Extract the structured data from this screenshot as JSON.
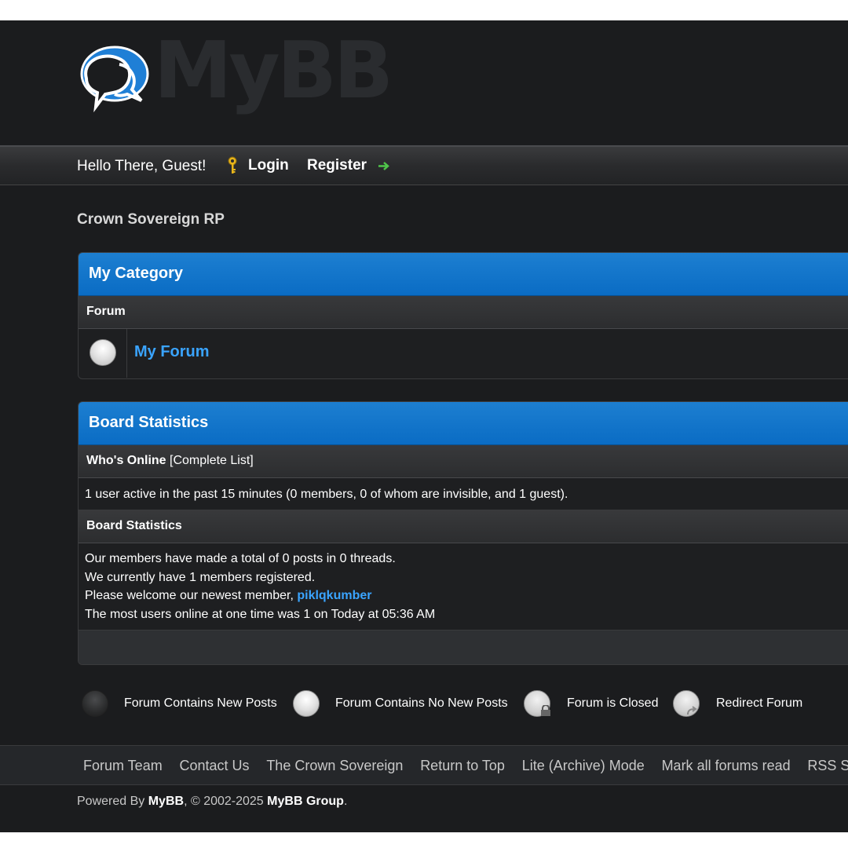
{
  "header": {
    "logo_text": "MyBB"
  },
  "top_bar": {
    "greeting": "Hello There, Guest!",
    "login": "Login",
    "register": "Register"
  },
  "breadcrumb": "Crown Sovereign RP",
  "category": {
    "title": "My Category",
    "column_header": "Forum",
    "forums": [
      {
        "name": "My Forum"
      }
    ]
  },
  "board_statistics": {
    "title": "Board Statistics",
    "whos_online_label": "Who's Online",
    "complete_list": "[Complete List]",
    "online_text": "1 user active in the past 15 minutes (0 members, 0 of whom are invisible, and 1 guest).",
    "stats_header": "Board Statistics",
    "line1": "Our members have made a total of 0 posts in 0 threads.",
    "line2": "We currently have 1 members registered.",
    "line3_prefix": "Please welcome our newest member, ",
    "newest_member": "piklqkumber",
    "line4": "The most users online at one time was 1 on Today at 05:36 AM"
  },
  "legend": {
    "new_posts": "Forum Contains New Posts",
    "no_new_posts": "Forum Contains No New Posts",
    "closed": "Forum is Closed",
    "redirect": "Redirect Forum"
  },
  "footer": {
    "links": [
      "Forum Team",
      "Contact Us",
      "The Crown Sovereign",
      "Return to Top",
      "Lite (Archive) Mode",
      "Mark all forums read",
      "RSS Syndication"
    ],
    "powered_prefix": "Powered By ",
    "powered_name": "MyBB",
    "copyright_mid": ", © 2002-2025 ",
    "group_name": "MyBB Group",
    "suffix": "."
  },
  "colors": {
    "accent": "#0a6cc4",
    "link": "#3aa4ff",
    "background": "#1b1c1e"
  }
}
